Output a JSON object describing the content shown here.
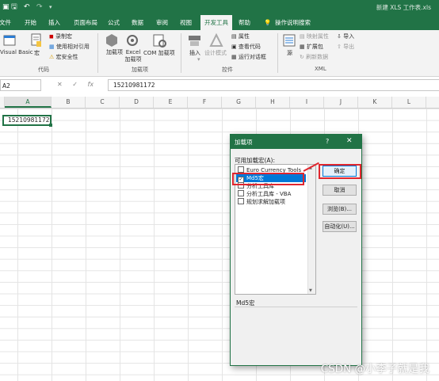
{
  "titlebar": {
    "icons": [
      "excel-icon",
      "save-icon",
      "undo-icon",
      "redo-icon",
      "customize-icon"
    ],
    "doc_title": "新建 XLS 工作表.xls"
  },
  "tabs": [
    {
      "label": "文件"
    },
    {
      "label": "开始"
    },
    {
      "label": "插入"
    },
    {
      "label": "页面布局"
    },
    {
      "label": "公式"
    },
    {
      "label": "数据"
    },
    {
      "label": "审阅"
    },
    {
      "label": "视图"
    },
    {
      "label": "开发工具",
      "active": true
    },
    {
      "label": "帮助"
    },
    {
      "label": "操作说明搜索"
    }
  ],
  "ribbon": {
    "code": {
      "visual_basic": "Visual Basic",
      "macros": "宏",
      "record_macro": "录制宏",
      "relative_refs": "使用相对引用",
      "macro_security": "宏安全性",
      "group": "代码"
    },
    "addins": {
      "addins": "加载项",
      "excel_addins": "Excel 加载项",
      "com_addins": "COM 加载项",
      "group": "加载项"
    },
    "controls": {
      "insert": "插入",
      "design_mode": "设计模式",
      "properties": "属性",
      "view_code": "查看代码",
      "run_dialog": "运行对话框",
      "group": "控件"
    },
    "xml": {
      "source": "源",
      "map_properties": "映射属性",
      "expansion_packs": "扩展包",
      "refresh_data": "刷新数据",
      "import": "导入",
      "export": "导出",
      "group": "XML"
    }
  },
  "formula_bar": {
    "name_box": "A2",
    "cancel": "✕",
    "enter": "✓",
    "fx": "fx",
    "value": "15210981172"
  },
  "columns": [
    "A",
    "B",
    "C",
    "D",
    "E",
    "F",
    "G",
    "H",
    "I",
    "J",
    "K",
    "L"
  ],
  "cell_a1": "15210981172",
  "dialog": {
    "title": "加载项",
    "help": "?",
    "close": "✕",
    "list_label": "可用加载宏(A):",
    "items": [
      {
        "label": "Euro Currency Tools",
        "checked": false,
        "selected": false
      },
      {
        "label": "Md5宏",
        "checked": true,
        "selected": true
      },
      {
        "label": "分析工具库",
        "checked": false,
        "selected": false
      },
      {
        "label": "分析工具库 - VBA",
        "checked": false,
        "selected": false
      },
      {
        "label": "规划求解加载项",
        "checked": false,
        "selected": false
      }
    ],
    "buttons": {
      "ok": "确定",
      "cancel": "取消",
      "browse": "浏览(B)...",
      "automation": "自动化(U)..."
    },
    "description": "Md5宏"
  },
  "annotation_color": "#e0262e",
  "accent_color": "#217346",
  "watermark": "CSDN @小李子就是我"
}
